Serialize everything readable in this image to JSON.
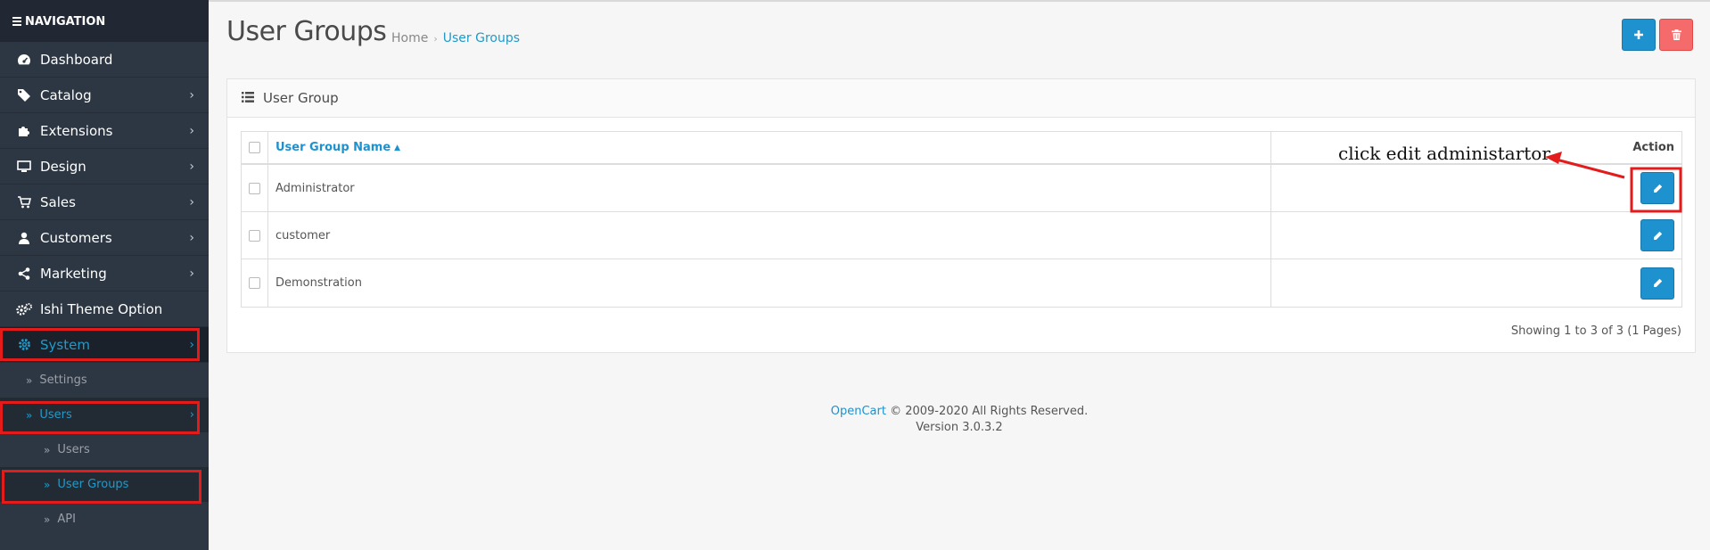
{
  "sidebar": {
    "header": "NAVIGATION",
    "menu": [
      {
        "label": "Dashboard",
        "icon": "dashboard-icon"
      },
      {
        "label": "Catalog",
        "icon": "tags-icon"
      },
      {
        "label": "Extensions",
        "icon": "puzzle-icon"
      },
      {
        "label": "Design",
        "icon": "desktop-icon"
      },
      {
        "label": "Sales",
        "icon": "cart-icon"
      },
      {
        "label": "Customers",
        "icon": "user-icon"
      },
      {
        "label": "Marketing",
        "icon": "share-icon"
      },
      {
        "label": "Ishi Theme Option",
        "icon": "gears-icon"
      },
      {
        "label": "System",
        "icon": "cog-icon"
      }
    ],
    "system_sub": {
      "settings": "Settings",
      "users": "Users",
      "users_sub": {
        "users": "Users",
        "user_groups": "User Groups",
        "api": "API"
      }
    }
  },
  "header": {
    "title": "User Groups",
    "breadcrumb": {
      "home": "Home",
      "current": "User Groups"
    }
  },
  "panel": {
    "title": "User Group",
    "columns": {
      "name": "User Group Name",
      "action": "Action"
    },
    "rows": [
      {
        "name": "Administrator"
      },
      {
        "name": "customer"
      },
      {
        "name": "Demonstration"
      }
    ],
    "pagination": "Showing 1 to 3 of 3 (1 Pages)"
  },
  "annotation": {
    "text": "click edit administartor",
    "color": "#e31b1b"
  },
  "footer": {
    "brand": "OpenCart",
    "copyright": "© 2009-2020 All Rights Reserved.",
    "version": "Version 3.0.3.2"
  },
  "colors": {
    "accent": "#1e91cf",
    "danger": "#f56b6b",
    "sidebar": "#2d3643"
  }
}
